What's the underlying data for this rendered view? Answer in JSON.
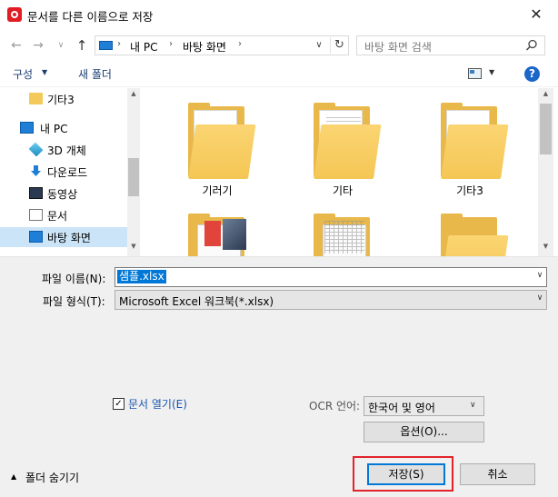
{
  "window": {
    "title": "문서를 다른 이름으로 저장",
    "close_glyph": "✕"
  },
  "address": {
    "sep": "›",
    "crumbs": [
      "내 PC",
      "바탕 화면"
    ],
    "search_placeholder": "바탕 화면 검색"
  },
  "nav_glyphs": {
    "back": "←",
    "forward": "→",
    "history": "∨",
    "up": "↑",
    "dropdown": "∨",
    "refresh": "↻"
  },
  "toolbar": {
    "organize": "구성",
    "organize_arrow": "▼",
    "new_folder": "새 폴더",
    "view_arrow": "▼",
    "help": "?"
  },
  "nav_pane": {
    "items": [
      "기타3",
      "내 PC",
      "3D 개체",
      "다운로드",
      "동영상",
      "문서",
      "바탕 화면"
    ],
    "selected": "바탕 화면",
    "scroll_up": "▲",
    "scroll_down": "▼"
  },
  "files": {
    "items": [
      "기러기",
      "기타",
      "기타3"
    ],
    "word_letter": "W",
    "scroll_up": "▲",
    "scroll_down": "▼"
  },
  "form": {
    "filename_label": "파일 이름(N):",
    "filename_value": "샘플.xlsx",
    "filetype_label": "파일 형식(T):",
    "filetype_value": "Microsoft Excel 워크북(*.xlsx)",
    "dropdown_arrow": "∨",
    "open_doc_checked": "✓",
    "open_doc_label": "문서 열기(E)",
    "ocr_label": "OCR 언어:",
    "ocr_value": "한국어 및 영어",
    "options_button": "옵션(O)...",
    "toggle_folders_icon": "▲",
    "toggle_folders": "폴더 숨기기",
    "save_button": "저장(S)",
    "cancel_button": "취소"
  },
  "colors": {
    "accent": "#0078d7",
    "highlight_border": "#e3232c",
    "selection": "#cce4f7"
  }
}
